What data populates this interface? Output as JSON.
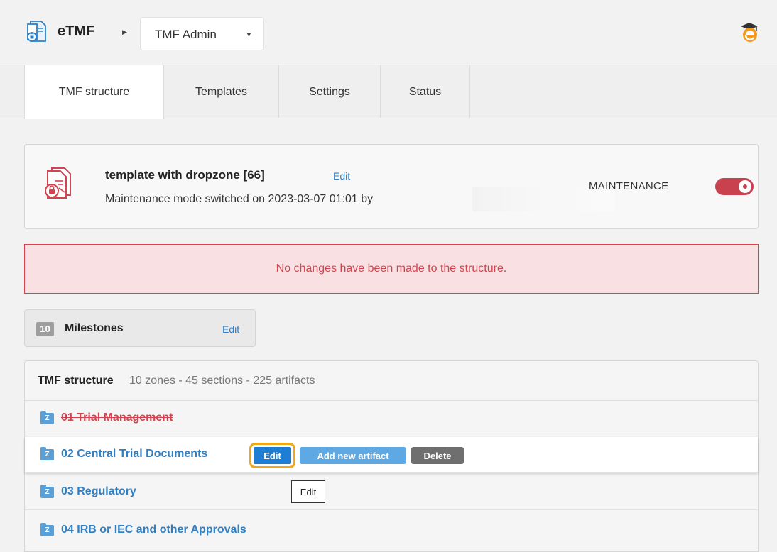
{
  "header": {
    "app_name": "eTMF",
    "admin_select": "TMF Admin"
  },
  "tabs": [
    {
      "label": "TMF structure",
      "active": true
    },
    {
      "label": "Templates",
      "active": false
    },
    {
      "label": "Settings",
      "active": false
    },
    {
      "label": "Status",
      "active": false
    }
  ],
  "template": {
    "title": "template with dropzone [66]",
    "edit_label": "Edit",
    "subtitle": "Maintenance mode switched on 2023-03-07 01:01 by",
    "maintenance_label": "MAINTENANCE",
    "maintenance_on": true
  },
  "alert": {
    "message": "No changes have been made to the structure."
  },
  "milestones": {
    "count": "10",
    "label": "Milestones",
    "edit_label": "Edit"
  },
  "tmf": {
    "title": "TMF structure",
    "summary": "10 zones - 45 sections - 225 artifacts",
    "zone_badge": "Z",
    "zones": [
      {
        "name": "01 Trial Management",
        "deleted": true
      },
      {
        "name": "02 Central Trial Documents",
        "deleted": false
      },
      {
        "name": "03 Regulatory",
        "deleted": false
      },
      {
        "name": "04 IRB or IEC and other Approvals",
        "deleted": false
      }
    ],
    "actions": {
      "edit": "Edit",
      "add": "Add new artifact",
      "delete": "Delete"
    }
  },
  "tooltip": "Edit",
  "colors": {
    "accent": "#1e7ed4",
    "danger": "#d2444f",
    "focus_outline": "#f0a818"
  }
}
